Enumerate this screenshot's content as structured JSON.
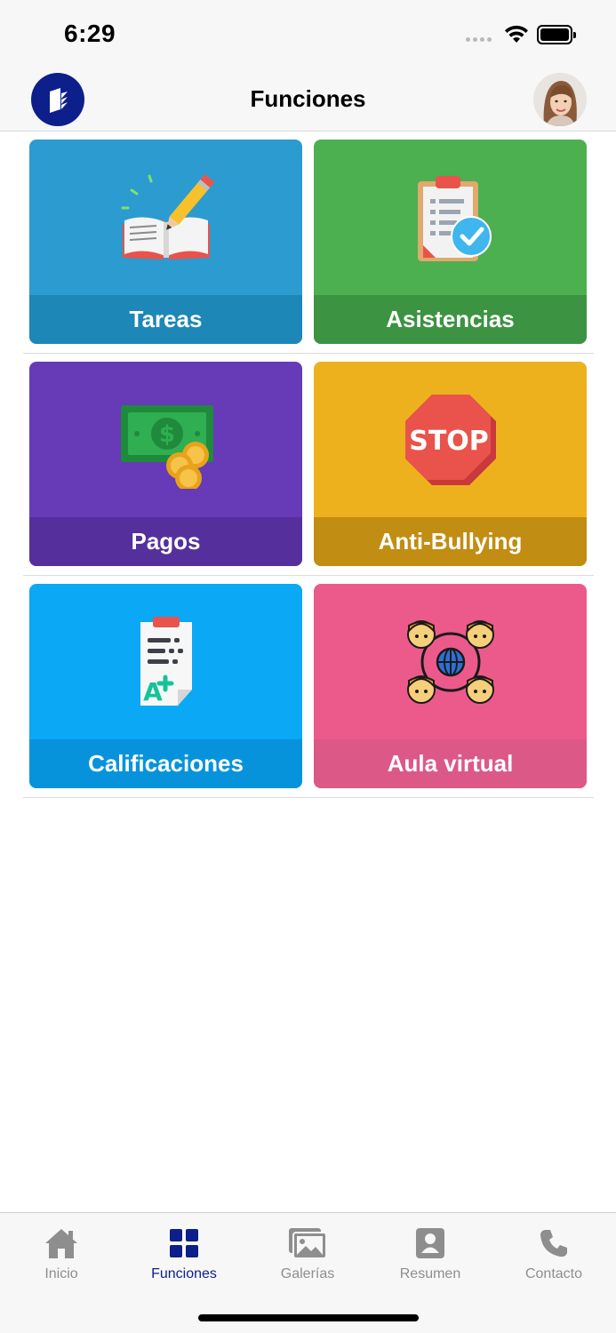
{
  "status": {
    "time": "6:29"
  },
  "header": {
    "title": "Funciones"
  },
  "tiles": [
    {
      "label": "Tareas",
      "icon": "notebook-pencil-icon",
      "color": "#2b9bd0",
      "label_bg": "#1d87b8"
    },
    {
      "label": "Asistencias",
      "icon": "clipboard-check-icon",
      "color": "#4caf50",
      "label_bg": "#3c9342"
    },
    {
      "label": "Pagos",
      "icon": "money-coins-icon",
      "color": "#673ab7",
      "label_bg": "#55309c"
    },
    {
      "label": "Anti-Bullying",
      "icon": "stop-sign-icon",
      "color": "#edb11e",
      "label_bg": "#c18d12",
      "stop_text": "STOP"
    },
    {
      "label": "Calificaciones",
      "icon": "grade-report-icon",
      "color": "#0aa8f5",
      "label_bg": "#0793dc"
    },
    {
      "label": "Aula virtual",
      "icon": "virtual-classroom-icon",
      "color": "#ec5a8b",
      "label_bg": "#dc5886"
    }
  ],
  "tabbar": {
    "items": [
      {
        "label": "Inicio",
        "icon": "home-icon",
        "active": false
      },
      {
        "label": "Funciones",
        "icon": "grid-icon",
        "active": true
      },
      {
        "label": "Galerías",
        "icon": "gallery-icon",
        "active": false
      },
      {
        "label": "Resumen",
        "icon": "profile-card-icon",
        "active": false
      },
      {
        "label": "Contacto",
        "icon": "phone-icon",
        "active": false
      }
    ],
    "active_color": "#0d1f8a",
    "inactive_color": "#8e8e8e"
  }
}
